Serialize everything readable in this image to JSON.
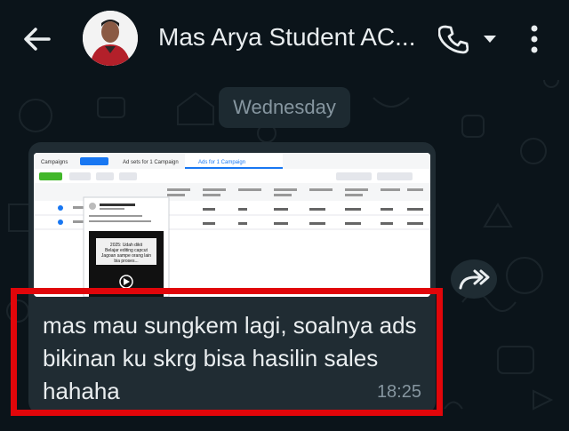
{
  "header": {
    "contact_name": "Mas Arya Student AC...",
    "icons": {
      "back": "arrow-left-icon",
      "call": "phone-icon",
      "call_dropdown": "caret-down-icon",
      "menu": "more-vertical-icon"
    }
  },
  "chat": {
    "day_label": "Wednesday",
    "message": {
      "text": "mas mau sungkem lagi, soalnya ads bikinan ku skrg bisa hasilin sales hahaha",
      "time": "18:25",
      "media": {
        "tabs": [
          "Campaigns",
          "Ad sets for 1 Campaign",
          "Ads for 1 Campaign"
        ],
        "video_caption": "2025: Udah dikit Belajar editing capcut Jagoan sampe orang lain bia proses..."
      }
    },
    "forward_icon": "forward-icon"
  },
  "colors": {
    "background": "#0b141a",
    "bubble": "#202c33",
    "highlight": "#e1060a",
    "text": "#e9edef",
    "meta_text": "#8696a0"
  }
}
